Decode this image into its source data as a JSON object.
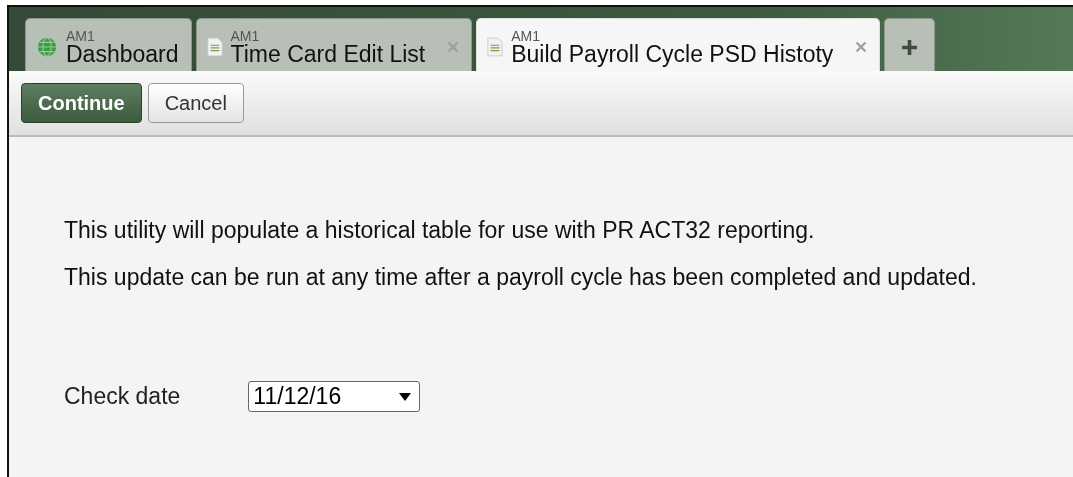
{
  "tabs": [
    {
      "server": "AM1",
      "label": "Dashboard",
      "kind": "globe",
      "closable": false,
      "selected": false
    },
    {
      "server": "AM1",
      "label": "Time Card Edit List",
      "kind": "document",
      "closable": true,
      "selected": false
    },
    {
      "server": "AM1",
      "label": "Build Payroll Cycle PSD Histoty",
      "kind": "document",
      "closable": true,
      "selected": true
    }
  ],
  "toolbar": {
    "buttons": [
      {
        "label": "Continue",
        "kind": "primary"
      },
      {
        "label": "Cancel",
        "kind": "secondary"
      }
    ]
  },
  "paragraphs": [
    "This utility will populate a historical table for use with PR ACT32 reporting.",
    "This update can be run at any time after a payroll cycle has been completed and updated."
  ],
  "check_date": {
    "label": "Check date",
    "value": "11/12/16"
  }
}
